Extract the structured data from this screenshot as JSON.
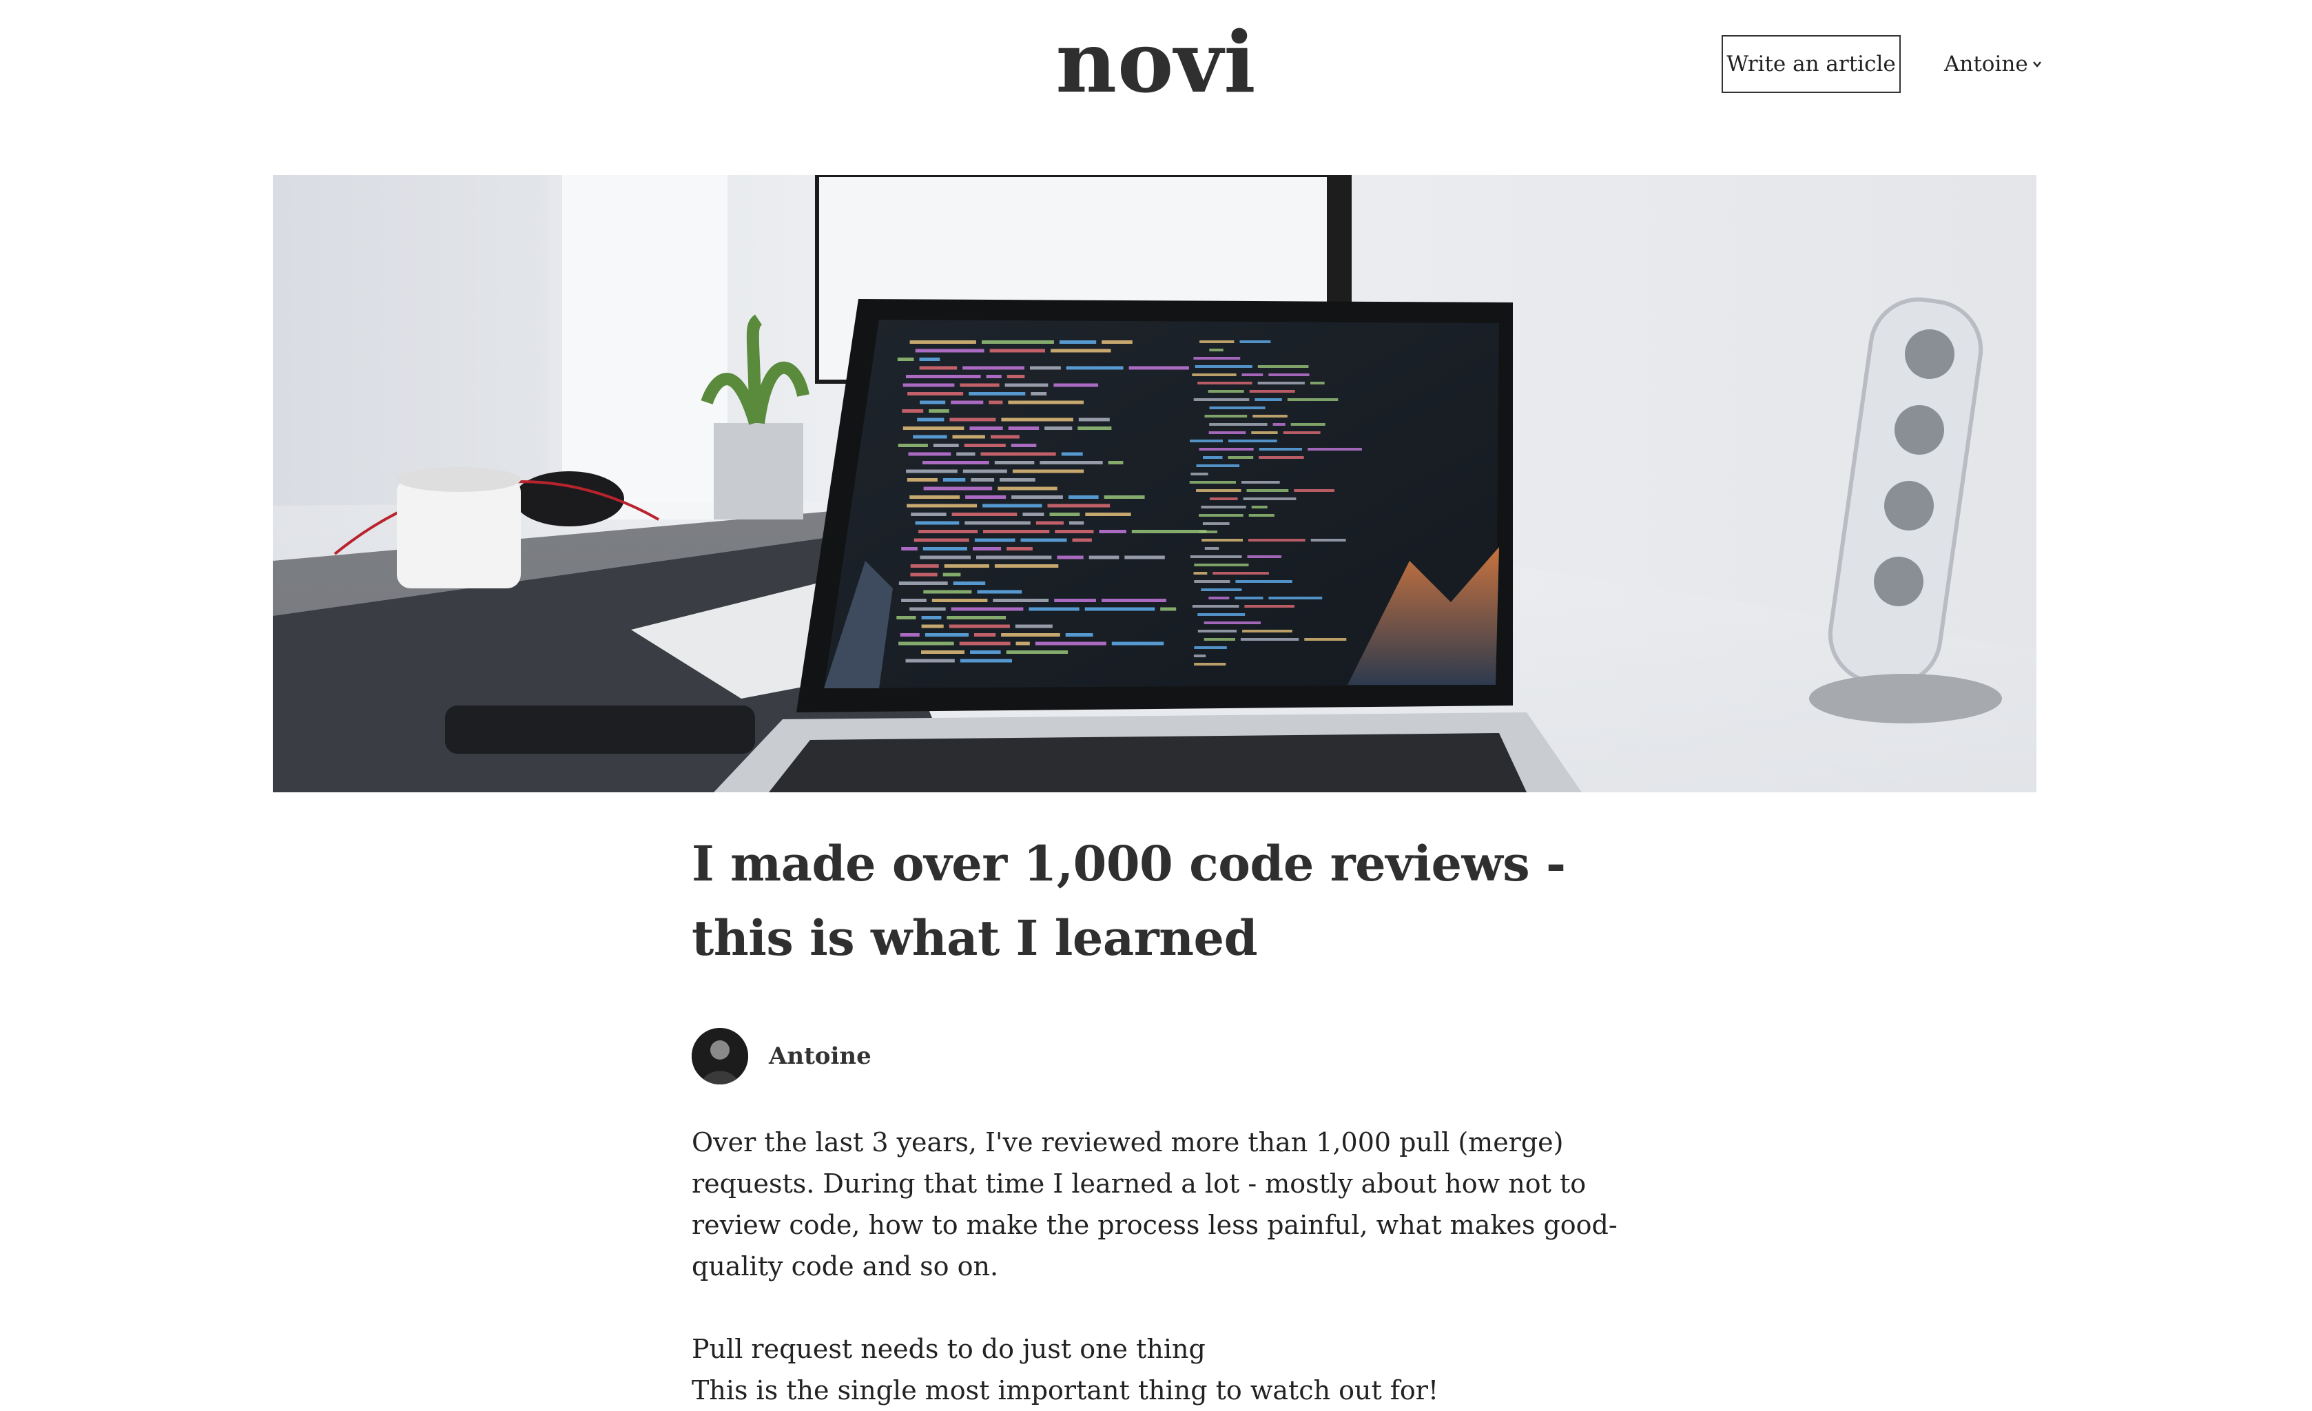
{
  "header": {
    "brand": "novi",
    "write_button": "Write an article",
    "user_name": "Antoine"
  },
  "hero": {
    "alt": "Laptop with code editor on desk"
  },
  "article": {
    "title": "I made over 1,000 code reviews - this is what I learned",
    "author": "Antoine",
    "paragraphs": [
      "Over the last 3 years, I've reviewed more than 1,000 pull (merge) requests. During that time I learned a lot - mostly about how not to review code, how to make the process less painful, what makes good-quality code and so on."
    ],
    "section_heading": "Pull request needs to do just one thing",
    "section_text": "This is the single most important thing to watch out for!"
  },
  "colors": {
    "text": "#333333",
    "background": "#ffffff",
    "button_border": "#333333"
  },
  "icons": {
    "user_menu": "chevron-down-icon"
  }
}
